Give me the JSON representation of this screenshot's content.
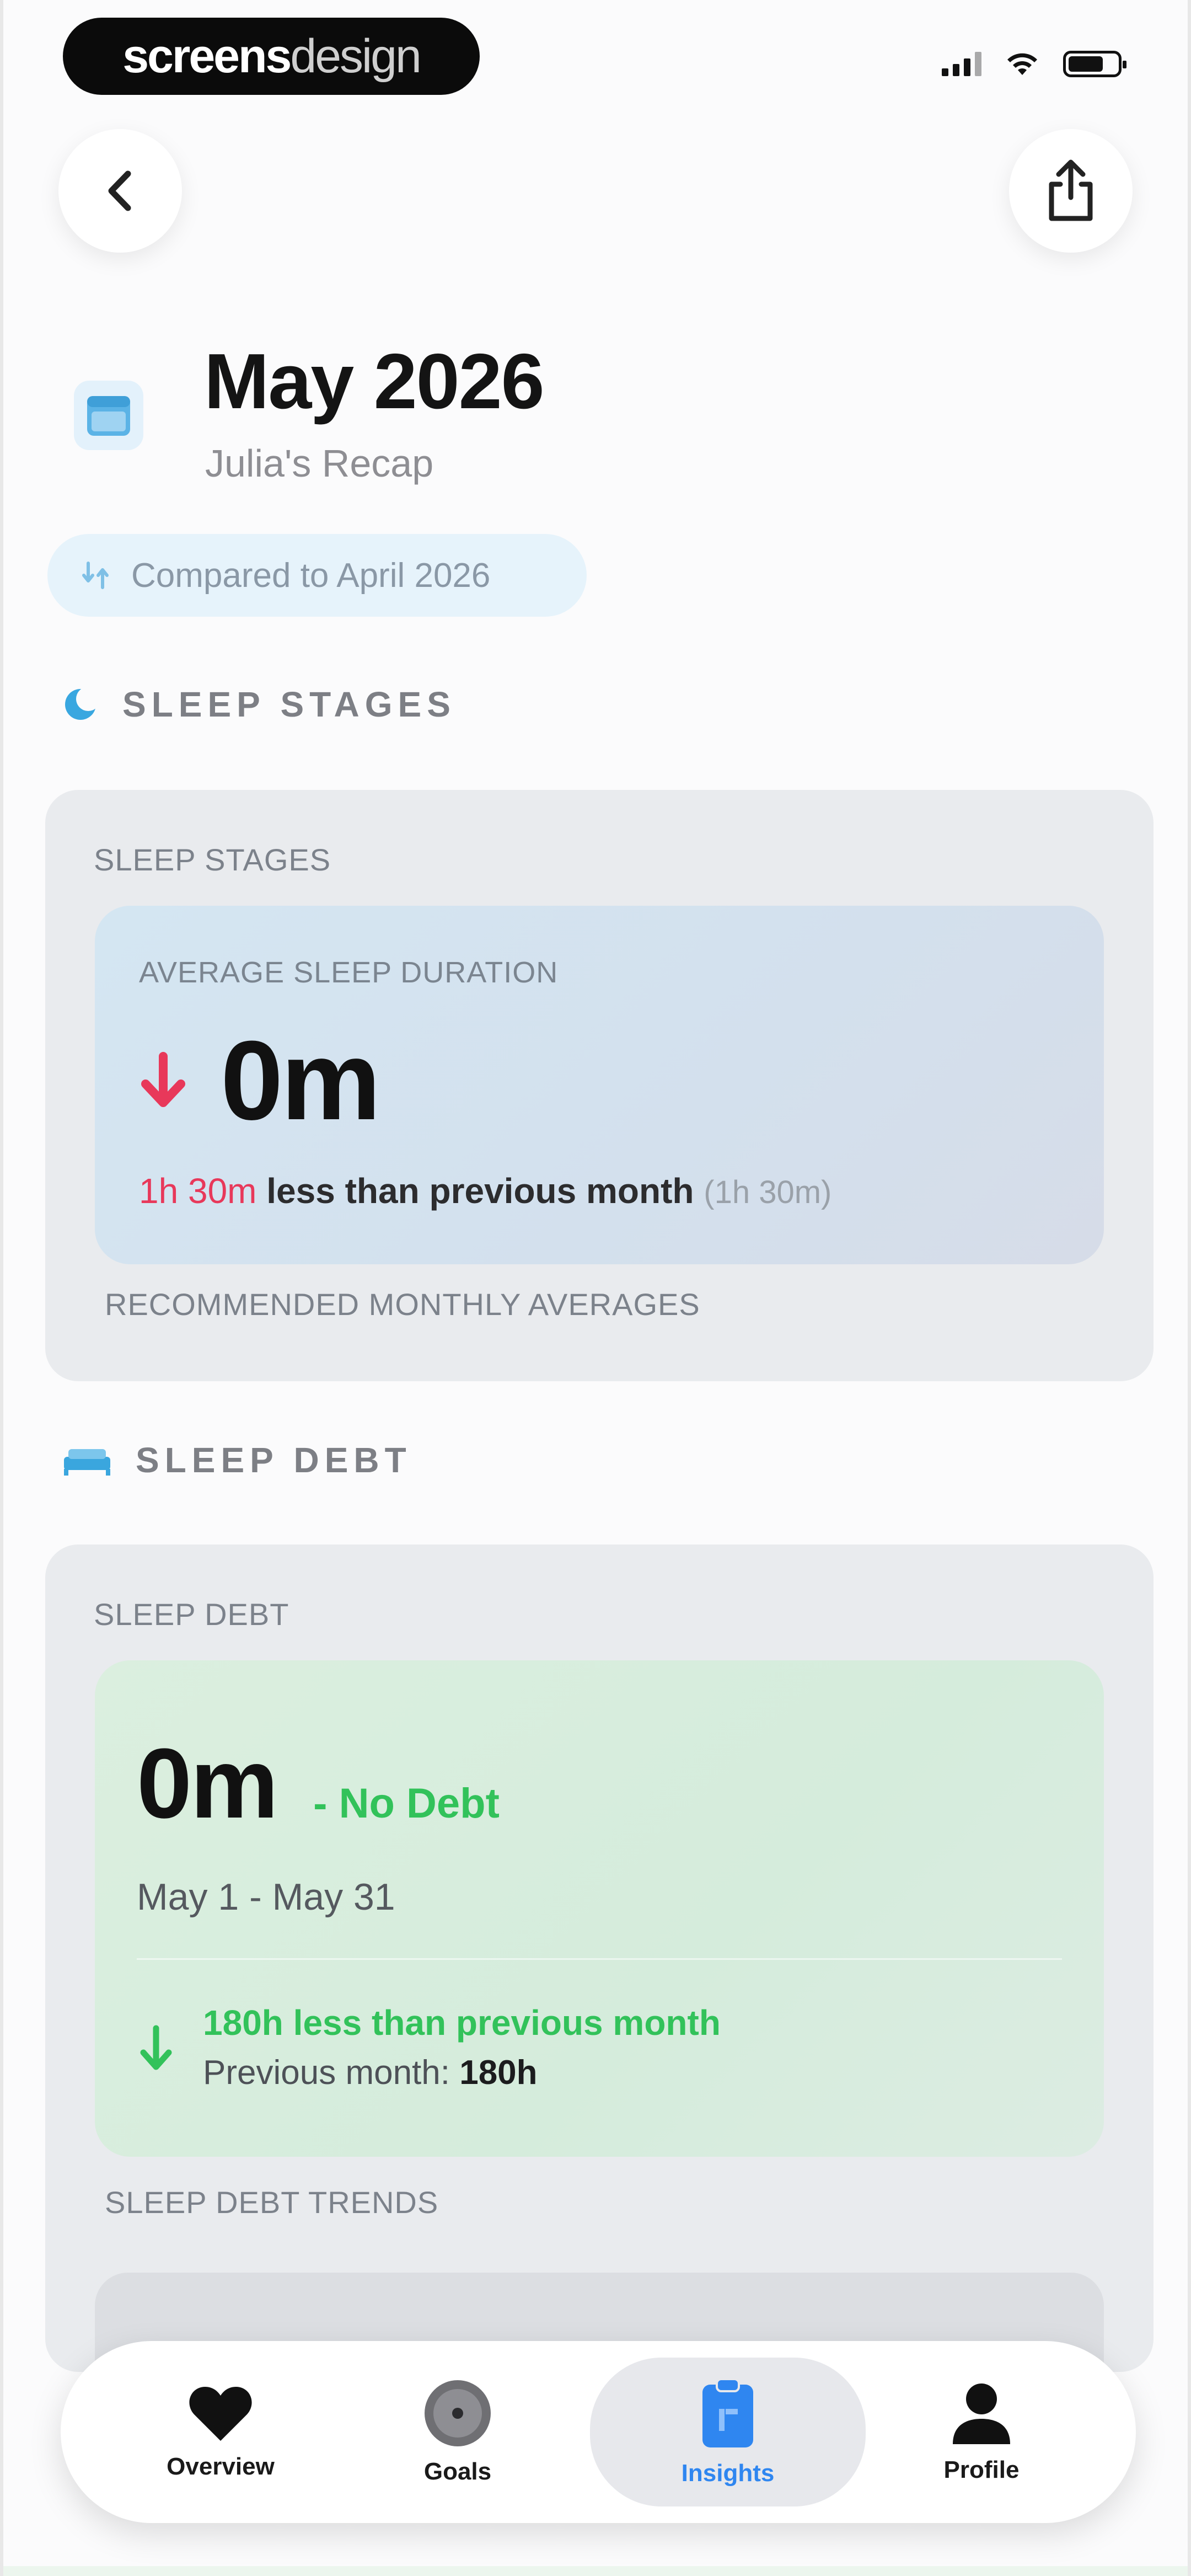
{
  "status_bar": {
    "logo_bold": "screens",
    "logo_light": "design"
  },
  "header": {
    "title": "May 2026",
    "subtitle": "Julia's Recap",
    "compare_label": "Compared to April 2026"
  },
  "sleep_stages": {
    "section_title": "SLEEP STAGES",
    "card_label": "SLEEP STAGES",
    "metric_label": "AVERAGE SLEEP DURATION",
    "value": "0m",
    "change_amount": "1h 30m",
    "change_text": "less than previous month",
    "previous_value": "(1h 30m)",
    "footer_label": "RECOMMENDED MONTHLY AVERAGES",
    "accent_color": "#e8385a"
  },
  "sleep_debt": {
    "section_title": "SLEEP DEBT",
    "card_label": "SLEEP DEBT",
    "value": "0m",
    "status": "- No Debt",
    "date_range": "May 1 - May 31",
    "trend_text": "180h less than previous month",
    "previous_label": "Previous month: ",
    "previous_value": "180h",
    "trends_label": "SLEEP DEBT TRENDS",
    "accent_color": "#32c25a"
  },
  "tabbar": {
    "tabs": [
      {
        "label": "Overview",
        "icon": "heart-icon"
      },
      {
        "label": "Goals",
        "icon": "target-icon"
      },
      {
        "label": "Insights",
        "icon": "clipboard-icon",
        "active": true
      },
      {
        "label": "Profile",
        "icon": "person-icon"
      }
    ],
    "active_color": "#2f86f0"
  }
}
